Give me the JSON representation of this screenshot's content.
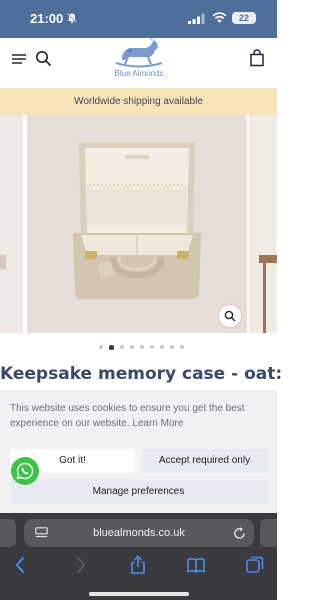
{
  "status_bar": {
    "time": "21:00",
    "battery": "22",
    "icons": [
      "bell-icon",
      "signal-icon",
      "wifi-icon",
      "battery-icon"
    ]
  },
  "header": {
    "brand_name": "Blue Almonds",
    "icons": [
      "menu-icon",
      "search-icon",
      "rocking-horse-logo",
      "cart-icon"
    ]
  },
  "promo": {
    "text": "Worldwide shipping available"
  },
  "carousel": {
    "slide_count": 9,
    "active_index": 1,
    "image_subject": "beige keepsake memory case, open"
  },
  "product": {
    "title": "Keepsake memory case - oat:"
  },
  "cookie_banner": {
    "text": "This website uses cookies to ensure you get the best experience on our website.",
    "learn_more": "Learn More",
    "got_it": "Got it!",
    "accept_required": "Accept required only",
    "manage": "Manage preferences"
  },
  "browser": {
    "url": "bluealmonds.co.uk",
    "toolbar_icons": [
      "back-icon",
      "forward-icon",
      "share-icon",
      "bookmarks-icon",
      "tabs-icon"
    ]
  },
  "colors": {
    "status_bar": "#4f6f9a",
    "promo_bg": "#f6e3b8",
    "brand": "#6b8fc4",
    "title": "#3a4a66",
    "whatsapp": "#3cc447",
    "browser_bg": "#3a3a3f",
    "browser_blue": "#4a8ef0"
  }
}
